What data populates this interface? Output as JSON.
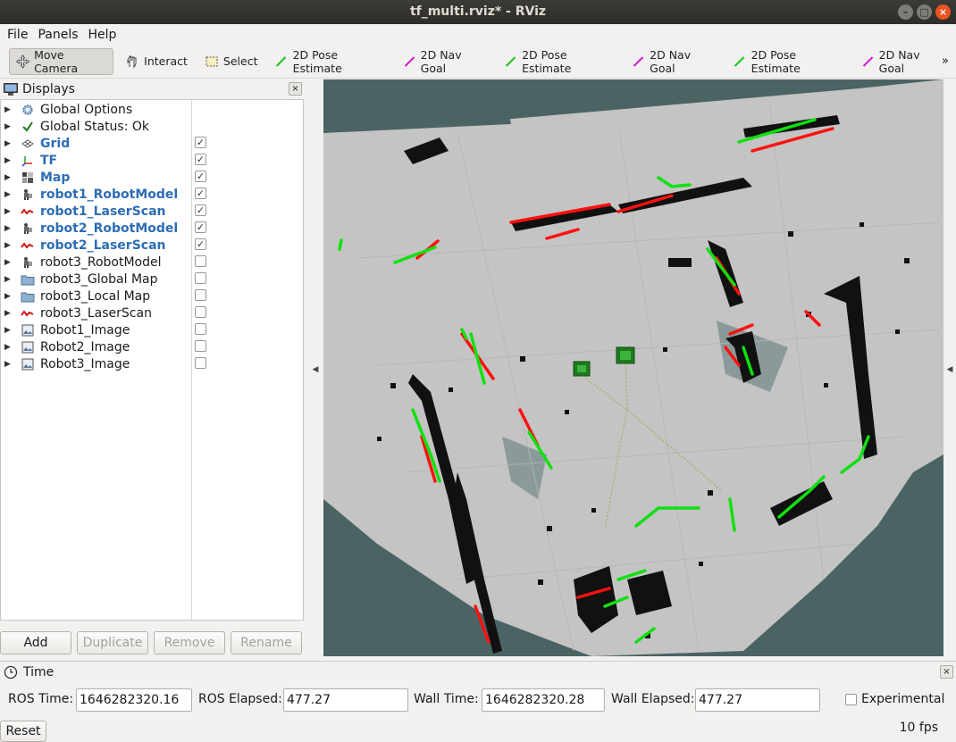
{
  "window": {
    "title": "tf_multi.rviz* - RViz",
    "controls": [
      "minimize",
      "maximize",
      "close"
    ]
  },
  "menu": [
    {
      "label": "File"
    },
    {
      "label": "Panels"
    },
    {
      "label": "Help"
    }
  ],
  "toolbar": {
    "tools": [
      {
        "label": "Move Camera",
        "icon": "move-camera-icon",
        "active": true
      },
      {
        "label": "Interact",
        "icon": "hand-icon"
      },
      {
        "label": "Select",
        "icon": "select-icon"
      },
      {
        "label": "2D Pose Estimate",
        "icon": "green-arrow-icon"
      },
      {
        "label": "2D Nav Goal",
        "icon": "magenta-arrow-icon"
      },
      {
        "label": "2D Pose Estimate",
        "icon": "green-arrow-icon"
      },
      {
        "label": "2D Nav Goal",
        "icon": "magenta-arrow-icon"
      },
      {
        "label": "2D Pose Estimate",
        "icon": "green-arrow-icon"
      },
      {
        "label": "2D Nav Goal",
        "icon": "magenta-arrow-icon"
      }
    ],
    "overflow": "»"
  },
  "displays": {
    "title": "Displays",
    "items": [
      {
        "label": "Global Options",
        "icon": "gear-icon",
        "bold": false,
        "checkbox": null
      },
      {
        "label": "Global Status: Ok",
        "icon": "checkmark-icon",
        "bold": false,
        "checkbox": null
      },
      {
        "label": "Grid",
        "icon": "grid-icon",
        "bold": true,
        "checkbox": true
      },
      {
        "label": "TF",
        "icon": "axes-icon",
        "bold": true,
        "checkbox": true
      },
      {
        "label": "Map",
        "icon": "map-icon",
        "bold": true,
        "checkbox": true
      },
      {
        "label": "robot1_RobotModel",
        "icon": "robot-icon",
        "bold": true,
        "checkbox": true
      },
      {
        "label": "robot1_LaserScan",
        "icon": "laser-icon",
        "bold": true,
        "checkbox": true
      },
      {
        "label": "robot2_RobotModel",
        "icon": "robot-icon",
        "bold": true,
        "checkbox": true
      },
      {
        "label": "robot2_LaserScan",
        "icon": "laser-icon",
        "bold": true,
        "checkbox": true
      },
      {
        "label": "robot3_RobotModel",
        "icon": "robot-icon",
        "bold": false,
        "checkbox": false
      },
      {
        "label": "robot3_Global Map",
        "icon": "folder-icon",
        "bold": false,
        "checkbox": false
      },
      {
        "label": "robot3_Local Map",
        "icon": "folder-icon",
        "bold": false,
        "checkbox": false
      },
      {
        "label": "robot3_LaserScan",
        "icon": "laser-icon",
        "bold": false,
        "checkbox": false
      },
      {
        "label": "Robot1_Image",
        "icon": "image-icon",
        "bold": false,
        "checkbox": false
      },
      {
        "label": "Robot2_Image",
        "icon": "image-icon",
        "bold": false,
        "checkbox": false
      },
      {
        "label": "Robot3_Image",
        "icon": "image-icon",
        "bold": false,
        "checkbox": false
      }
    ],
    "buttons": [
      {
        "label": "Add",
        "enabled": true
      },
      {
        "label": "Duplicate",
        "enabled": false
      },
      {
        "label": "Remove",
        "enabled": false
      },
      {
        "label": "Rename",
        "enabled": false
      }
    ]
  },
  "time": {
    "title": "Time",
    "ros_time_label": "ROS Time:",
    "ros_time": "1646282320.16",
    "ros_elapsed_label": "ROS Elapsed:",
    "ros_elapsed": "477.27",
    "wall_time_label": "Wall Time:",
    "wall_time": "1646282320.28",
    "wall_elapsed_label": "Wall Elapsed:",
    "wall_elapsed": "477.27",
    "experimental_label": "Experimental",
    "experimental_checked": false,
    "reset_label": "Reset",
    "fps": "10 fps"
  },
  "colors": {
    "unknown": "#4c6363",
    "free": "#c4c4c4",
    "occupied": "#111111",
    "laser_red": "#ff1010",
    "laser_green": "#10e010",
    "accent_bold": "#2d6db5"
  }
}
